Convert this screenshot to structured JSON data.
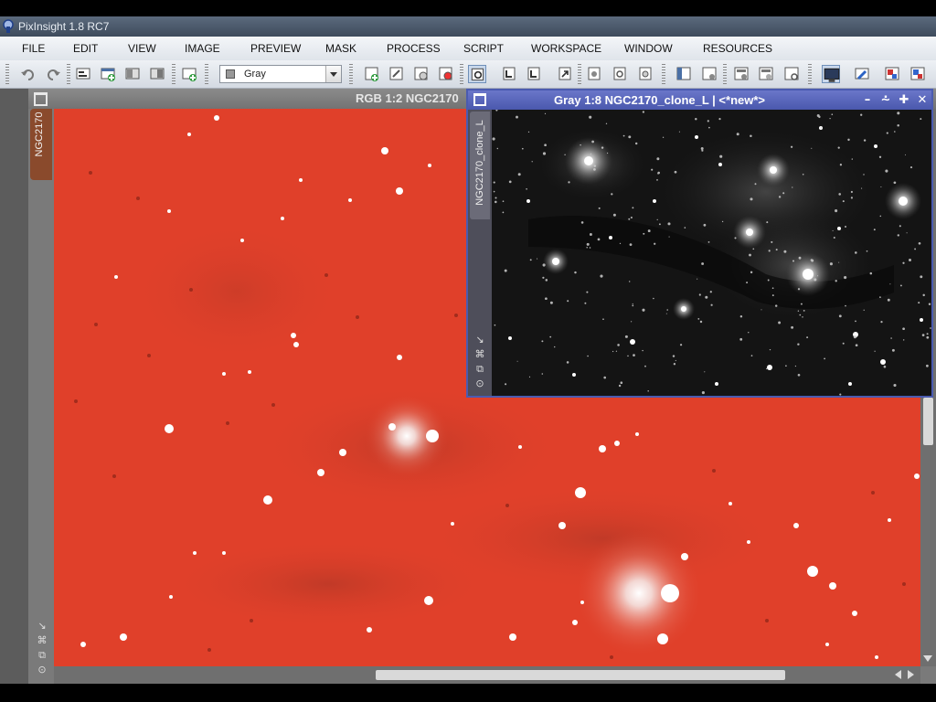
{
  "app": {
    "title": "PixInsight 1.8 RC7"
  },
  "menu": {
    "items": [
      {
        "label": "FILE"
      },
      {
        "label": "EDIT"
      },
      {
        "label": "VIEW"
      },
      {
        "label": "IMAGE"
      },
      {
        "label": "PREVIEW"
      },
      {
        "label": "MASK"
      },
      {
        "label": "PROCESS"
      },
      {
        "label": "SCRIPT"
      },
      {
        "label": "WORKSPACE"
      },
      {
        "label": "WINDOW"
      },
      {
        "label": "RESOURCES"
      }
    ]
  },
  "toolbar": {
    "mask_mode_value": "Gray",
    "icons": [
      "undo-icon",
      "redo-icon",
      "new-view-icon",
      "new-preview-icon",
      "image-window-icon",
      "close-view-icon",
      "new-image-icon",
      "zoom-in-icon",
      "zoom-out-icon",
      "fit-view-icon",
      "readout-icon",
      "mode-icon-1",
      "mode-icon-2",
      "mode-icon-3",
      "mode-icon-4",
      "stf-icon-1",
      "stf-icon-2",
      "stf-icon-3",
      "stf-icon-4",
      "stf-icon-5",
      "stf-icon-6",
      "layout-icon-1",
      "layout-icon-2",
      "layout-icon-3",
      "layout-icon-4",
      "monitor-icon",
      "explorer-icon",
      "process-icon-1",
      "process-icon-2"
    ]
  },
  "rgb_view": {
    "title": "RGB 1:2 NGC2170",
    "identifier_tab": "NGC2170",
    "background_color": "#e0402a"
  },
  "gray_view": {
    "title": "Gray 1:8 NGC2170_clone_L | <*new*>",
    "identifier_tab": "NGC2170_clone_L",
    "controls": [
      "minimize-icon",
      "shade-icon",
      "maximize-icon",
      "close-icon"
    ],
    "control_glyphs": [
      "–",
      "⩪",
      "✚",
      "✕"
    ],
    "border_color": "#4b5bb0"
  },
  "side_tools": [
    "↘",
    "⌘",
    "⧉",
    "⊙"
  ]
}
